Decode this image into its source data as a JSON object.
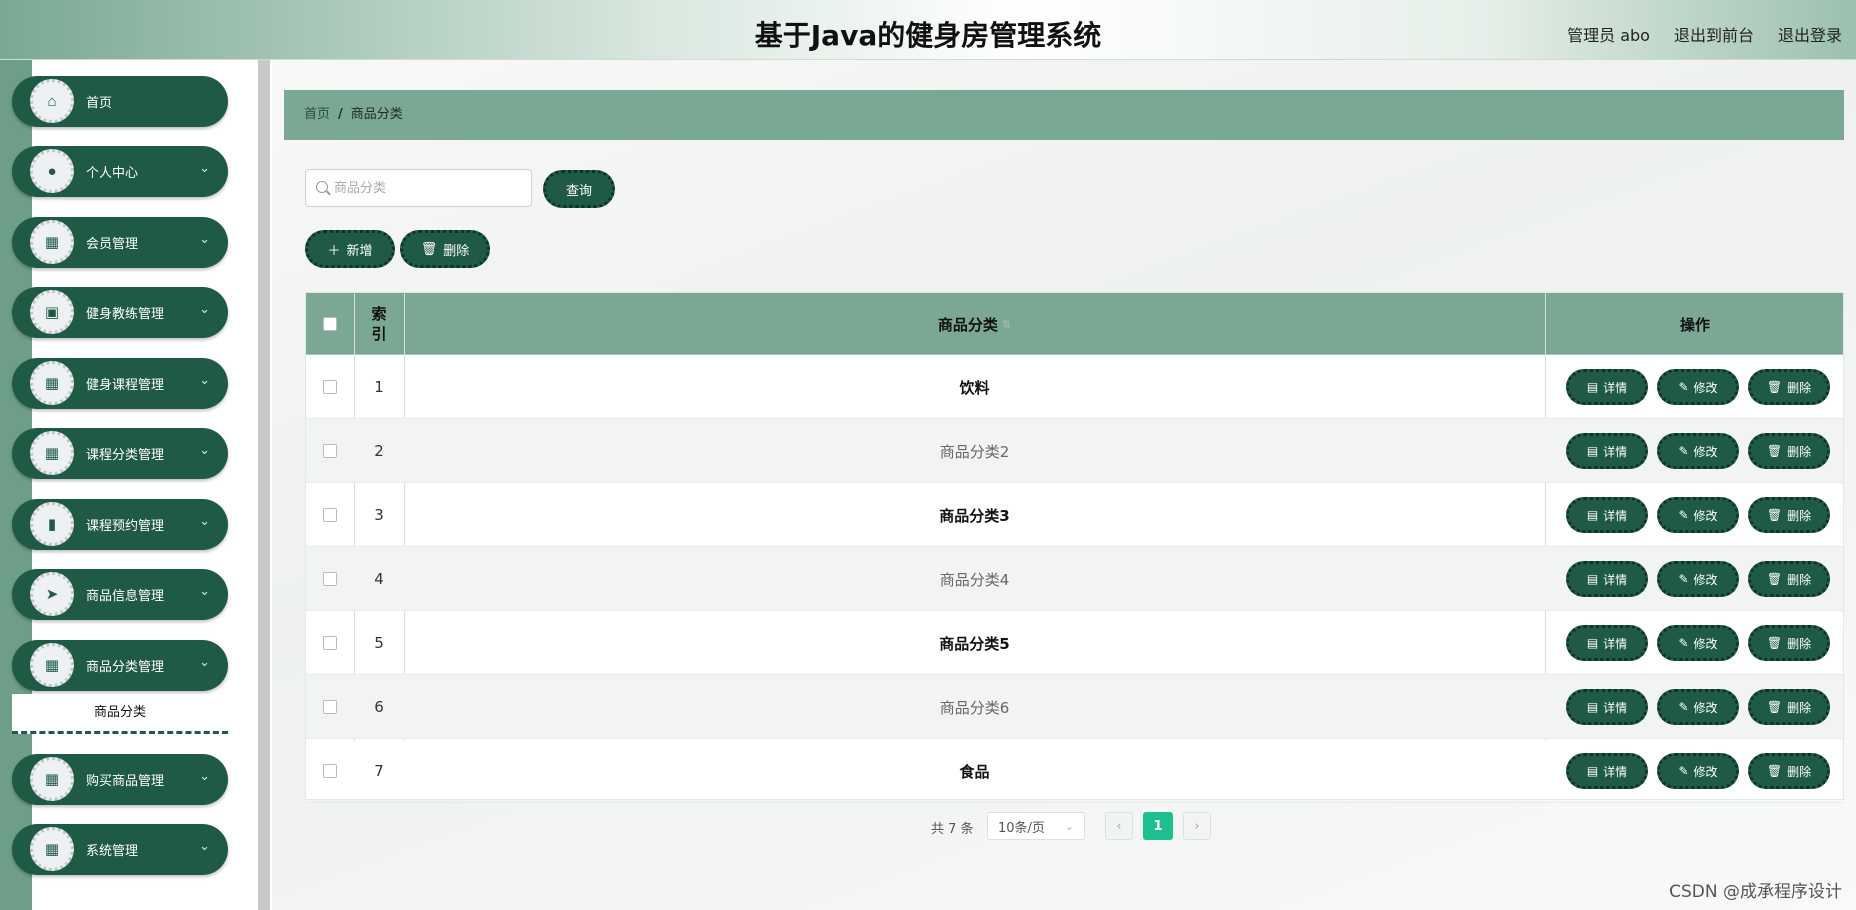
{
  "header": {
    "title": "基于Java的健身房管理系统",
    "admin": "管理员 abo",
    "to_front": "退出到前台",
    "logout": "退出登录"
  },
  "sidebar": {
    "items": [
      {
        "label": "首页",
        "icon": "home-icon",
        "glyph": "⌂"
      },
      {
        "label": "个人中心",
        "icon": "user-icon",
        "glyph": "●"
      },
      {
        "label": "会员管理",
        "icon": "grid-icon",
        "glyph": "▦"
      },
      {
        "label": "健身教练管理",
        "icon": "clipboard-icon",
        "glyph": "▣"
      },
      {
        "label": "健身课程管理",
        "icon": "grid-icon",
        "glyph": "▦"
      },
      {
        "label": "课程分类管理",
        "icon": "grid-icon",
        "glyph": "▦"
      },
      {
        "label": "课程预约管理",
        "icon": "bar-chart-icon",
        "glyph": "▮"
      },
      {
        "label": "商品信息管理",
        "icon": "send-icon",
        "glyph": "➤"
      },
      {
        "label": "商品分类管理",
        "icon": "grid-icon",
        "glyph": "▦"
      },
      {
        "label": "购买商品管理",
        "icon": "grid-icon",
        "glyph": "▦"
      },
      {
        "label": "系统管理",
        "icon": "grid-icon",
        "glyph": "▦"
      }
    ],
    "submenu_active": "商品分类"
  },
  "breadcrumb": {
    "home": "首页",
    "separator": "/",
    "current": "商品分类"
  },
  "search": {
    "placeholder": "商品分类",
    "value": "",
    "button": "查询"
  },
  "toolbar": {
    "add_label": "新增",
    "delete_label": "删除"
  },
  "table": {
    "headers": {
      "index": "索\n引",
      "name": "商品分类",
      "actions": "操作"
    },
    "rows": [
      {
        "index": "1",
        "name": "饮料"
      },
      {
        "index": "2",
        "name": "商品分类2"
      },
      {
        "index": "3",
        "name": "商品分类3"
      },
      {
        "index": "4",
        "name": "商品分类4"
      },
      {
        "index": "5",
        "name": "商品分类5"
      },
      {
        "index": "6",
        "name": "商品分类6"
      },
      {
        "index": "7",
        "name": "食品"
      }
    ],
    "row_actions": {
      "detail": "详情",
      "edit": "修改",
      "delete": "删除"
    }
  },
  "pagination": {
    "total": "共 7 条",
    "page_size": "10条/页",
    "current_page": "1",
    "prev": "‹",
    "next": "›"
  },
  "watermark": "CSDN @成承程序设计",
  "colors": {
    "primary": "#1e5a44",
    "header_bg": "#7aa895",
    "active_page": "#1dbf8f"
  }
}
